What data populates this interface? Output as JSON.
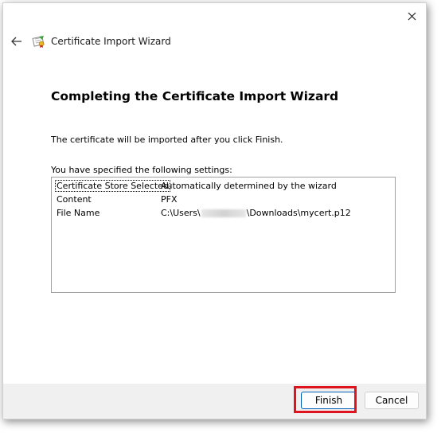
{
  "window": {
    "title": "Certificate Import Wizard"
  },
  "heading": "Completing the Certificate Import Wizard",
  "body_text": "The certificate will be imported after you click Finish.",
  "settings_label": "You have specified the following settings:",
  "settings": [
    {
      "key": "Certificate Store Selected",
      "value": "Automatically determined by the wizard"
    },
    {
      "key": "Content",
      "value": "PFX"
    },
    {
      "key": "File Name",
      "value_prefix": "C:\\Users\\",
      "value_suffix": "\\Downloads\\mycert.p12"
    }
  ],
  "buttons": {
    "finish": "Finish",
    "cancel": "Cancel"
  },
  "colors": {
    "highlight": "#e0141e",
    "finish_border": "#005fb8",
    "footer_bg": "#f0f0f0"
  },
  "icons": {
    "close": "close-icon",
    "back": "back-arrow-icon",
    "certificate": "certificate-icon"
  }
}
